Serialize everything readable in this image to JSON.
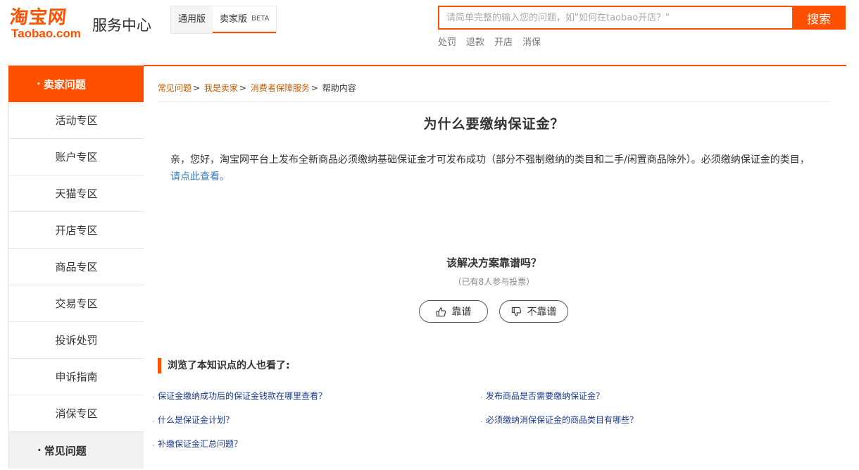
{
  "header": {
    "logo_cn": "淘宝网",
    "logo_en": "Taobao.com",
    "site_title": "服务中心",
    "tabs": [
      {
        "label": "通用版",
        "beta": ""
      },
      {
        "label": "卖家版",
        "beta": "BETA"
      }
    ],
    "search": {
      "placeholder": "请简单完整的输入您的问题，如\"如何在taobao开店？\"",
      "button": "搜索"
    },
    "hot_words": [
      "处罚",
      "退款",
      "开店",
      "消保"
    ]
  },
  "sidebar": {
    "section1": "卖家问题",
    "items": [
      "活动专区",
      "账户专区",
      "天猫专区",
      "开店专区",
      "商品专区",
      "交易专区",
      "投诉处罚",
      "申诉指南",
      "消保专区"
    ],
    "section2": "常见问题"
  },
  "breadcrumb": {
    "items": [
      "常见问题",
      "我是卖家",
      "消费者保障服务"
    ],
    "current": "帮助内容",
    "separator": ">"
  },
  "article": {
    "title": "为什么要缴纳保证金？",
    "body": "亲，您好，淘宝网平台上发布全新商品必须缴纳基础保证金才可发布成功（部分不强制缴纳的类目和二手/闲置商品除外）。必须缴纳保证金的类目，",
    "link": "请点此查看",
    "link_end": "。"
  },
  "vote": {
    "question": "该解决方案靠谱吗？",
    "count": "（已有8人参与投票）",
    "yes": "靠谱",
    "no": "不靠谱"
  },
  "related": {
    "heading": "浏览了本知识点的人也看了:",
    "links": [
      "保证金缴纳成功后的保证金钱款在哪里查看？",
      "发布商品是否需要缴纳保证金？",
      "什么是保证金计划？",
      "必须缴纳消保保证金的商品类目有哪些？",
      "补缴保证金汇总问题？"
    ]
  },
  "colors": {
    "brand": "#ff5000",
    "link": "#3b7bbf",
    "breadcrumb_link": "#c35a00"
  }
}
